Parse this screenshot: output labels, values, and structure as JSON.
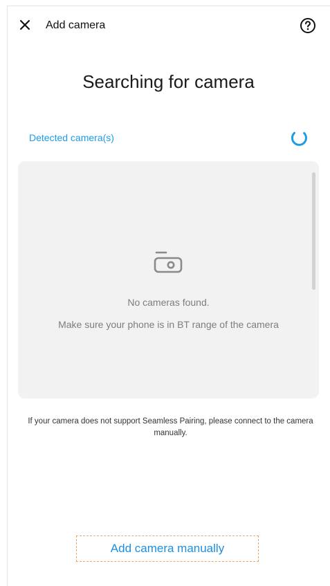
{
  "header": {
    "title": "Add camera",
    "close_icon": "close-icon",
    "help_icon": "help-icon"
  },
  "main": {
    "title": "Searching for camera",
    "detected_label": "Detected camera(s)",
    "spinner_icon": "loading-spinner-icon",
    "empty_state": {
      "icon": "camera-icon",
      "line1": "No cameras found.",
      "line2": "Make sure your phone is in BT range of the camera"
    },
    "info_text": "If your camera does not support Seamless Pairing, please connect to the camera manually.",
    "add_manual_label": "Add camera manually"
  },
  "colors": {
    "accent": "#1b9ce3",
    "dashed_border": "#f0a463",
    "panel_bg": "#f2f2f3",
    "muted_text": "#7d7d7d"
  }
}
